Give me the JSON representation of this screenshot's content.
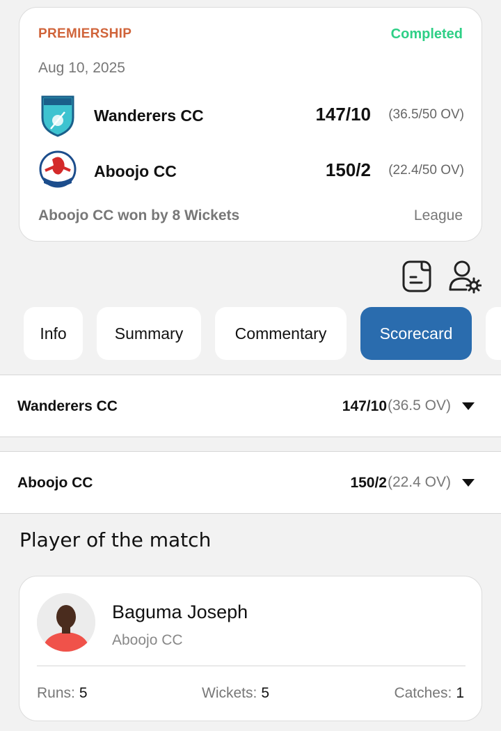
{
  "match": {
    "league": "PREMIERSHIP",
    "status": "Completed",
    "date": "Aug 10, 2025",
    "teams": [
      {
        "name": "Wanderers CC",
        "score": "147/10",
        "overs": "(36.5/50 OV)",
        "logo_icon": "wanderers-logo"
      },
      {
        "name": "Aboojo CC",
        "score": "150/2",
        "overs": "(22.4/50 OV)",
        "logo_icon": "aboojo-logo"
      }
    ],
    "result": "Aboojo CC won by 8 Wickets",
    "type": "League"
  },
  "actions": {
    "scorecard_icon": "document-icon",
    "settings_icon": "user-gear-icon"
  },
  "tabs": [
    {
      "label": "Info",
      "active": false
    },
    {
      "label": "Summary",
      "active": false
    },
    {
      "label": "Commentary",
      "active": false
    },
    {
      "label": "Scorecard",
      "active": true
    }
  ],
  "innings": [
    {
      "team": "Wanderers CC",
      "score": "147/10",
      "overs": "(36.5 OV)"
    },
    {
      "team": "Aboojo CC",
      "score": "150/2",
      "overs": "(22.4 OV)"
    }
  ],
  "player_of_match": {
    "title": "Player of the match",
    "name": "Baguma Joseph",
    "team": "Aboojo CC",
    "stats": [
      {
        "label": "Runs:",
        "value": "5"
      },
      {
        "label": "Wickets:",
        "value": "5"
      },
      {
        "label": "Catches:",
        "value": "1"
      }
    ]
  },
  "colors": {
    "league": "#d0643a",
    "status": "#2ecf86",
    "active_tab": "#2a6cae"
  }
}
